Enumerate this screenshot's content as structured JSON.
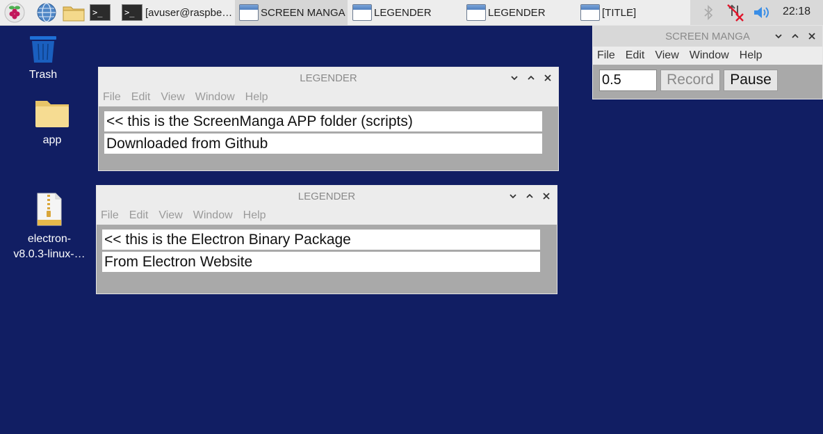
{
  "taskbar": {
    "launchers": [
      {
        "icon": "raspberry-menu-icon"
      },
      {
        "icon": "web-browser-globe-icon"
      },
      {
        "icon": "file-manager-folder-icon"
      },
      {
        "icon": "terminal-icon"
      }
    ],
    "tasks": [
      {
        "icon": "terminal-icon",
        "label": "[avuser@raspbe…"
      },
      {
        "icon": "window-icon",
        "label": "SCREEN MANGA",
        "active": true
      },
      {
        "icon": "window-icon",
        "label": "LEGENDER"
      },
      {
        "icon": "window-icon",
        "label": "LEGENDER"
      },
      {
        "icon": "window-icon",
        "label": "[TITLE]"
      }
    ],
    "tray": {
      "icons": [
        "bluetooth-icon",
        "network-disconnected-icon",
        "volume-icon"
      ],
      "clock": "22:18"
    }
  },
  "desktop": {
    "icons": [
      {
        "icon": "trash-icon",
        "label": "Trash"
      },
      {
        "icon": "folder-icon",
        "label": "app"
      },
      {
        "icon": "zip-archive-icon",
        "label_line1": "electron-",
        "label_line2": "v8.0.3-linux-…"
      }
    ]
  },
  "windows": {
    "legender1": {
      "title": "LEGENDER",
      "menu": [
        "File",
        "Edit",
        "View",
        "Window",
        "Help"
      ],
      "lines": [
        "<< this is the ScreenManga APP folder (scripts)",
        "Downloaded from Github"
      ]
    },
    "legender2": {
      "title": "LEGENDER",
      "menu": [
        "File",
        "Edit",
        "View",
        "Window",
        "Help"
      ],
      "lines": [
        "<< this is the Electron Binary Package",
        "From Electron Website"
      ]
    },
    "screen_manga": {
      "title": "SCREEN MANGA",
      "menu": [
        "File",
        "Edit",
        "View",
        "Window",
        "Help"
      ],
      "input_value": "0.5",
      "record_label": "Record",
      "pause_label": "Pause"
    }
  },
  "colors": {
    "desktop_bg": "#111e63",
    "window_body": "#a9a9a9",
    "titlebar": "#ececec"
  }
}
